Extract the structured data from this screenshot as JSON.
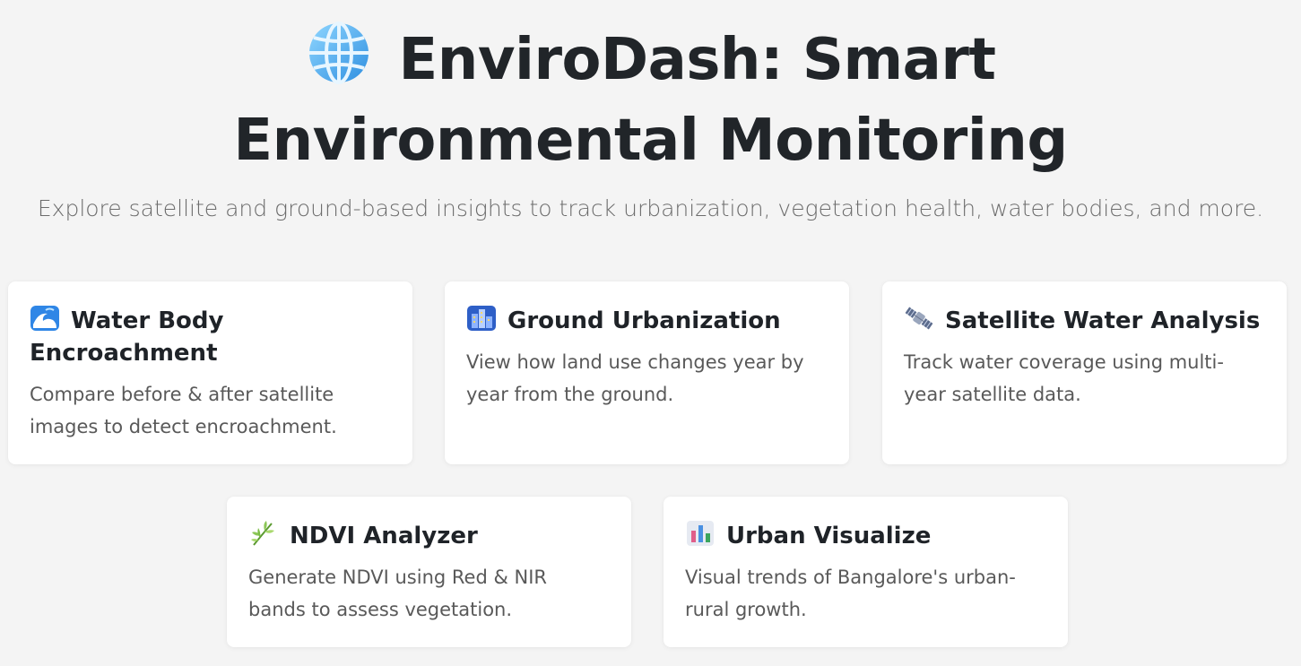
{
  "header": {
    "icon": "globe-icon",
    "title": "EnviroDash: Smart Environmental Monitoring",
    "subtitle": "Explore satellite and ground-based insights to track urbanization, vegetation health, water bodies, and more."
  },
  "cards": [
    {
      "icon": "water-wave-icon",
      "title": "Water Body Encroachment",
      "description": "Compare before & after satellite images to detect encroachment."
    },
    {
      "icon": "city-icon",
      "title": "Ground Urbanization",
      "description": "View how land use changes year by year from the ground."
    },
    {
      "icon": "satellite-icon",
      "title": "Satellite Water Analysis",
      "description": "Track water coverage using multi-year satellite data."
    },
    {
      "icon": "herb-icon",
      "title": "NDVI Analyzer",
      "description": "Generate NDVI using Red & NIR bands to assess vegetation."
    },
    {
      "icon": "bar-chart-icon",
      "title": "Urban Visualize",
      "description": "Visual trends of Bangalore's urban-rural growth."
    }
  ],
  "colors": {
    "background": "#f4f4f4",
    "card": "#ffffff",
    "title": "#212529",
    "muted": "#595959"
  }
}
